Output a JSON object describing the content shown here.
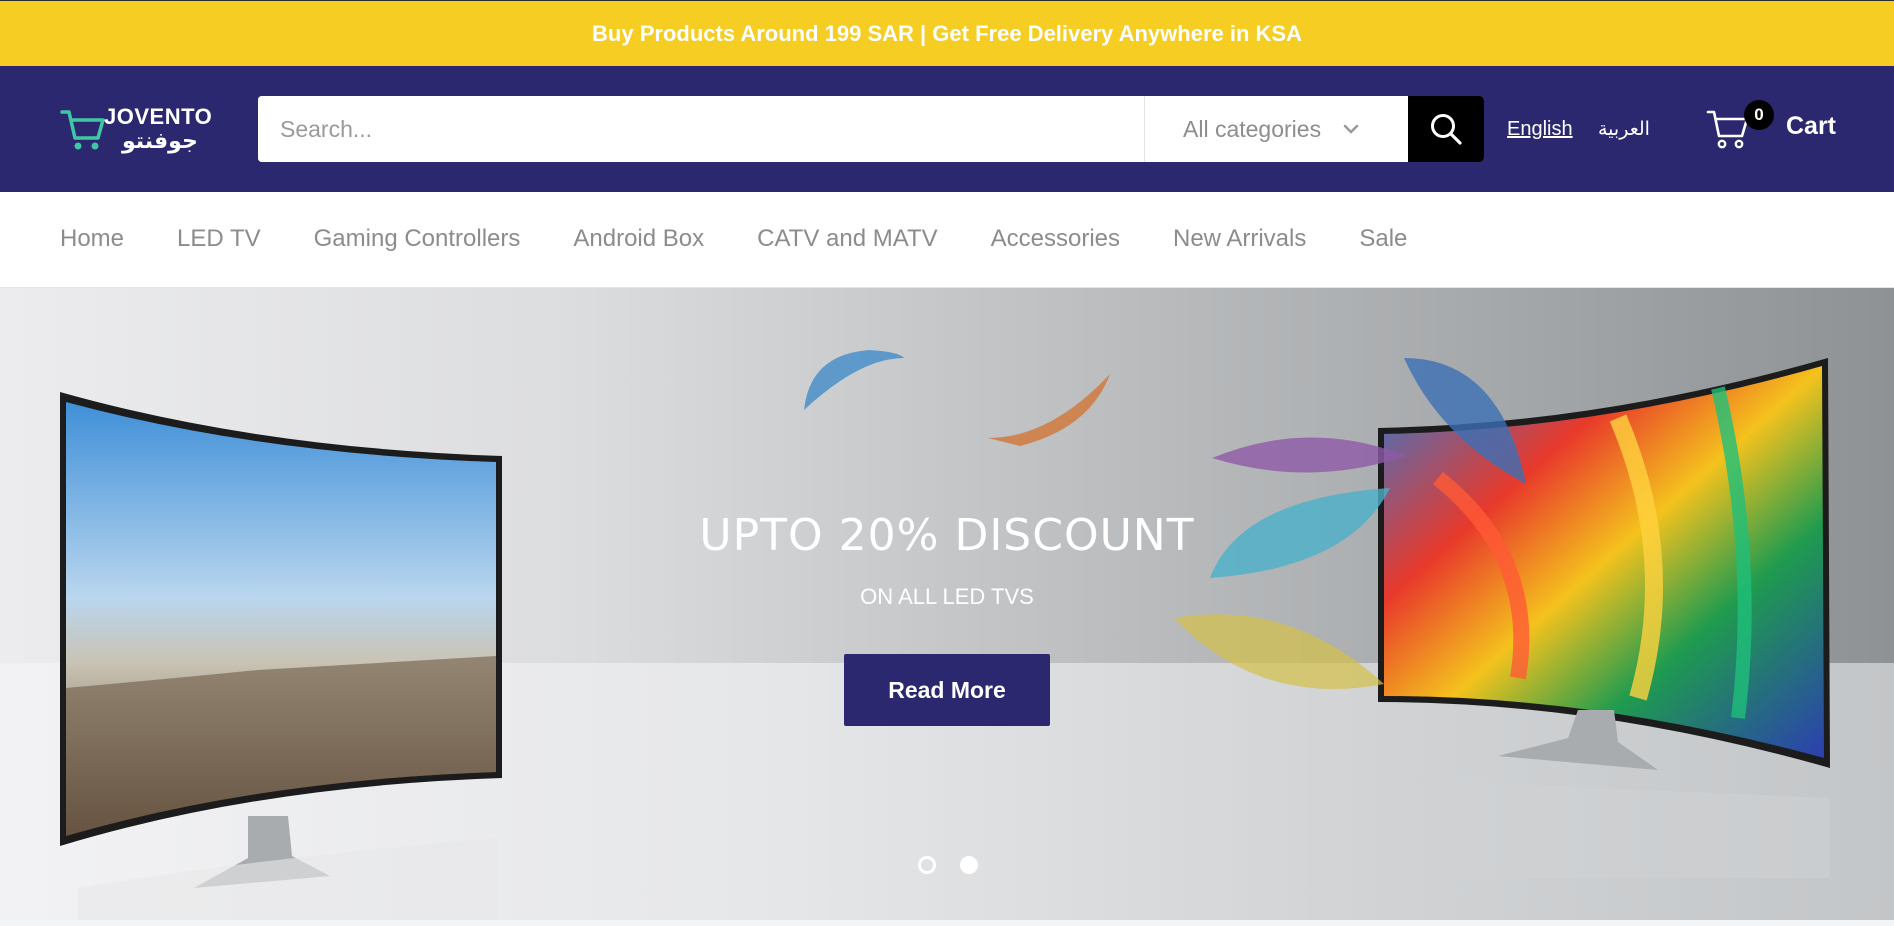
{
  "announcement": {
    "text": "Buy Products Around 199 SAR | Get Free Delivery Anywhere in KSA"
  },
  "header": {
    "logo_en": "JOVENTO",
    "logo_ar": "جوفنتو",
    "search": {
      "placeholder": "Search...",
      "value": ""
    },
    "category_select": {
      "selected": "All categories"
    },
    "languages": {
      "english": "English",
      "arabic": "العربية"
    },
    "cart": {
      "label": "Cart",
      "count": "0"
    }
  },
  "nav": {
    "items": [
      {
        "label": "Home"
      },
      {
        "label": "LED TV"
      },
      {
        "label": "Gaming Controllers"
      },
      {
        "label": "Android Box"
      },
      {
        "label": "CATV and MATV"
      },
      {
        "label": "Accessories"
      },
      {
        "label": "New Arrivals"
      },
      {
        "label": "Sale"
      }
    ]
  },
  "hero": {
    "title": "UPTO 20% DISCOUNT",
    "subtitle": "ON ALL LED TVS",
    "cta": "Read More",
    "slides": {
      "count": 2,
      "active_index": 1
    }
  },
  "colors": {
    "announcement_bg": "#f5cd23",
    "header_bg": "#2b2870",
    "accent_green": "#3fc7a5",
    "button_bg": "#2b2870"
  },
  "icons": {
    "logo_cart": "shopping-cart-icon",
    "search": "search-icon",
    "chevron": "chevron-down-icon",
    "cart": "cart-icon"
  }
}
